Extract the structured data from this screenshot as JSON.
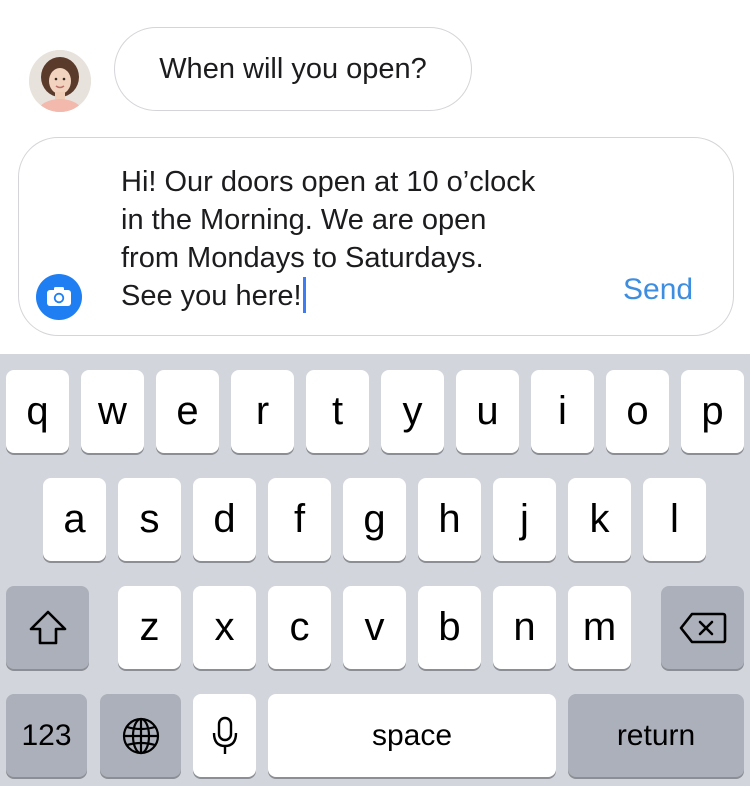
{
  "chat": {
    "incoming_message": "When will you open?",
    "avatar_description": "user photo"
  },
  "composer": {
    "draft_text": "Hi! Our doors open at 10 o’clock in the Morning. We are open from Mondays to Saturdays. See you here!",
    "send_label": "Send",
    "camera_icon": "camera-icon",
    "accent_color": "#1f7ff2"
  },
  "keyboard": {
    "row1": [
      "q",
      "w",
      "e",
      "r",
      "t",
      "y",
      "u",
      "i",
      "o",
      "p"
    ],
    "row2": [
      "a",
      "s",
      "d",
      "f",
      "g",
      "h",
      "j",
      "k",
      "l"
    ],
    "row3": [
      "z",
      "x",
      "c",
      "v",
      "b",
      "n",
      "m"
    ],
    "numbers_label": "123",
    "space_label": "space",
    "return_label": "return",
    "icons": [
      "shift-icon",
      "backspace-icon",
      "globe-icon",
      "microphone-icon"
    ]
  }
}
